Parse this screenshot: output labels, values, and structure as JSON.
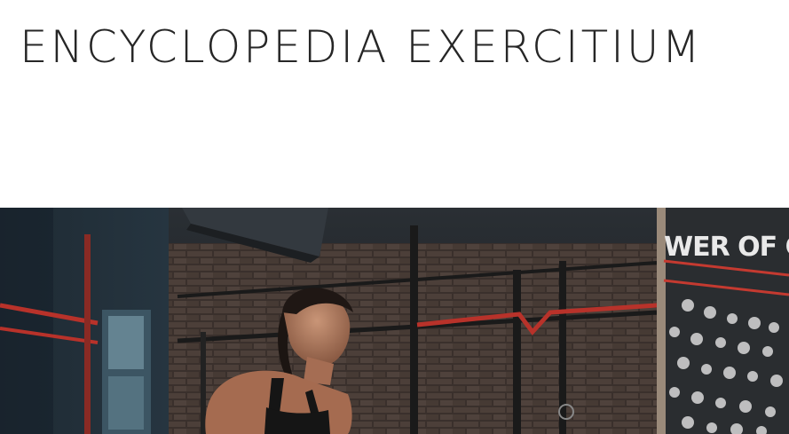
{
  "site": {
    "title": "ENCYCLOPEDIA EXERCITIUM"
  },
  "hero": {
    "wall_text": "WER OF COM"
  },
  "colors": {
    "title": "#262626",
    "brick": "#5a4a42",
    "rig_red": "#b8322a",
    "chalkboard": "#2a2d30"
  }
}
